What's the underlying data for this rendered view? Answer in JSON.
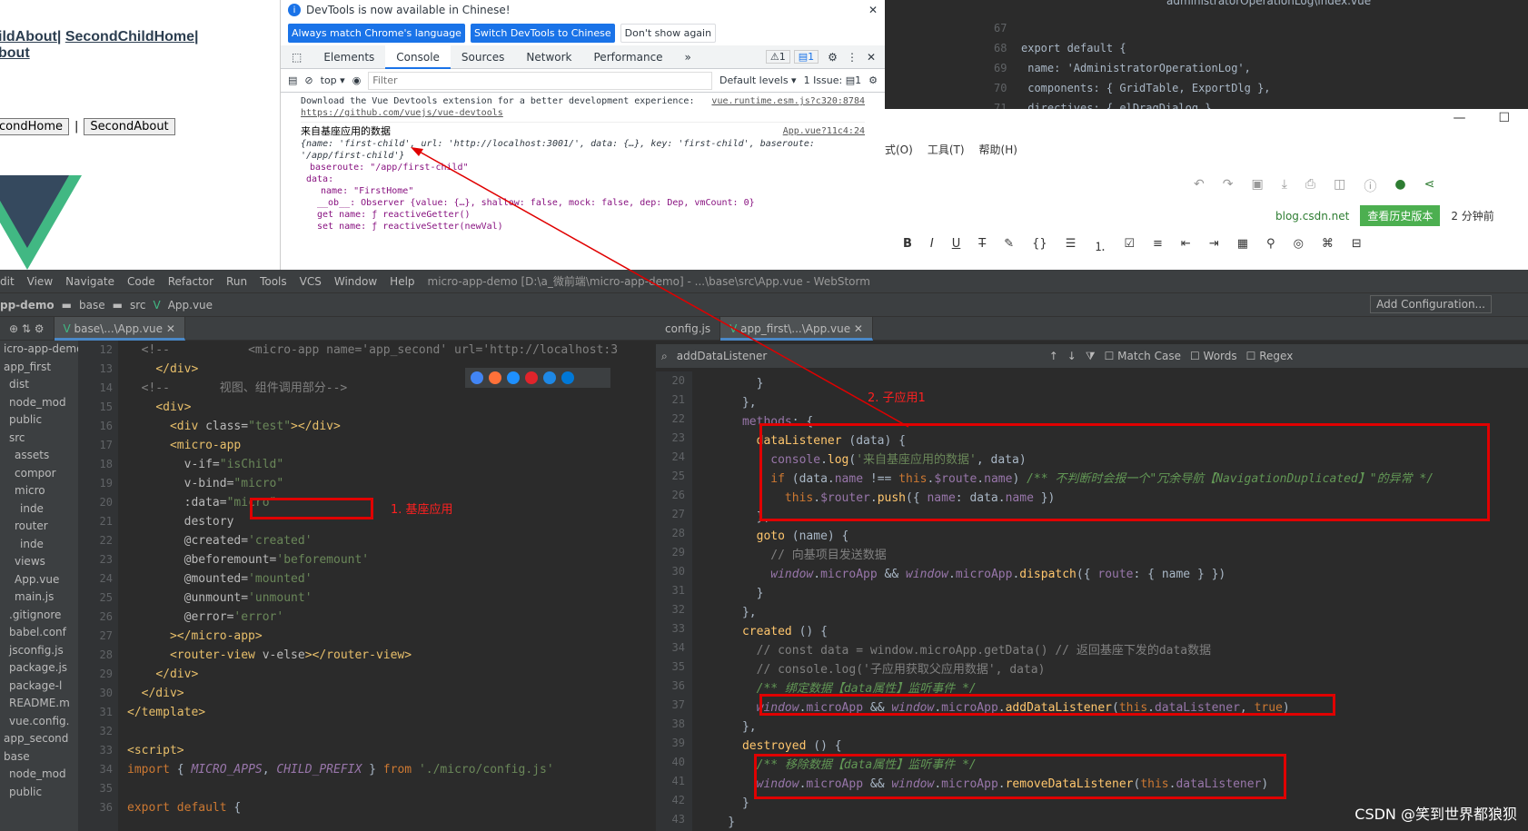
{
  "browser": {
    "nav_line1_a": "ildAbout",
    "nav_sep": "|",
    "nav_line1_b": "SecondChildHome",
    "nav_sep2": "|",
    "nav_line2": "bout",
    "btn1": "condHome",
    "btn_sep": "|",
    "btn2": "SecondAbout"
  },
  "devtools": {
    "info_text": "DevTools is now available in Chinese!",
    "btn_match": "Always match Chrome's language",
    "btn_switch": "Switch DevTools to Chinese",
    "btn_dont": "Don't show again",
    "tabs": [
      "Elements",
      "Console",
      "Sources",
      "Network",
      "Performance"
    ],
    "active_tab": "Console",
    "warn_count": "1",
    "msg_count": "1",
    "context": "top",
    "filter_placeholder": "Filter",
    "levels": "Default levels",
    "issue_label": "1 Issue:",
    "issue_count": "1",
    "log1_text": "Download the Vue Devtools extension for a better development experience:",
    "log1_link": "https://github.com/vuejs/vue-devtools",
    "log1_src": "vue.runtime.esm.js?c320:8784",
    "log2_text": "来自基座应用的数据",
    "log2_src": "App.vue?11c4:24",
    "log2_obj": "{name: 'first-child', url: 'http://localhost:3001/', data: {…}, key: 'first-child', baseroute: '/app/first-child'}",
    "log2_baseroute": "baseroute: \"/app/first-child\"",
    "log2_data": "data:",
    "log2_name": "name: \"FirstHome\"",
    "log2_ob": "__ob__: Observer {value: {…}, shallow: false, mock: false, dep: Dep, vmCount: 0}",
    "log2_get": "get name: ƒ reactiveGetter()",
    "log2_set": "set name: ƒ reactiveSetter(newVal)"
  },
  "ide_top": {
    "lines": [
      {
        "n": "67",
        "t": ""
      },
      {
        "n": "68",
        "t": "export default {"
      },
      {
        "n": "69",
        "t": "  name: 'AdministratorOperationLog',"
      },
      {
        "n": "70",
        "t": "  components: { GridTable, ExportDlg },"
      },
      {
        "n": "71",
        "t": "  directives: { elDragDialog },"
      }
    ],
    "tab": "administratorOperationLog\\index.vue"
  },
  "editor": {
    "menu": [
      "式(O)",
      "工具(T)",
      "帮助(H)"
    ],
    "blog": "blog.csdn.net",
    "history": "查看历史版本",
    "time_ago": "2 分钟前"
  },
  "webstorm": {
    "menu": [
      "dit",
      "View",
      "Navigate",
      "Code",
      "Refactor",
      "Run",
      "Tools",
      "VCS",
      "Window",
      "Help"
    ],
    "title": "micro-app-demo [D:\\a_微前端\\micro-app-demo] - ...\\base\\src\\App.vue - WebStorm",
    "crumbs": [
      "pp-demo",
      "base",
      "src",
      "App.vue"
    ],
    "add_config": "Add Configuration...",
    "left_tab": "base\\...\\App.vue",
    "right_tabs": [
      "config.js",
      "app_first\\...\\App.vue"
    ],
    "search_query": "addDataListener",
    "search_opts": [
      "Match Case",
      "Words",
      "Regex"
    ],
    "project": [
      "icro-app-demo",
      "app_first",
      "dist",
      "node_mod",
      "public",
      "src",
      "assets",
      "compor",
      "micro",
      "inde",
      "router",
      "inde",
      "views",
      "App.vue",
      "main.js",
      ".gitignore",
      "babel.conf",
      "jsconfig.js",
      "package.js",
      "package-l",
      "README.m",
      "vue.config.",
      "app_second",
      "base",
      "node_mod",
      "public"
    ],
    "left_start": 12,
    "right_start": 20
  },
  "annotations": {
    "base_app": "1. 基座应用",
    "child_app": "2. 子应用1"
  },
  "watermark": "CSDN @笑到世界都狼狈"
}
